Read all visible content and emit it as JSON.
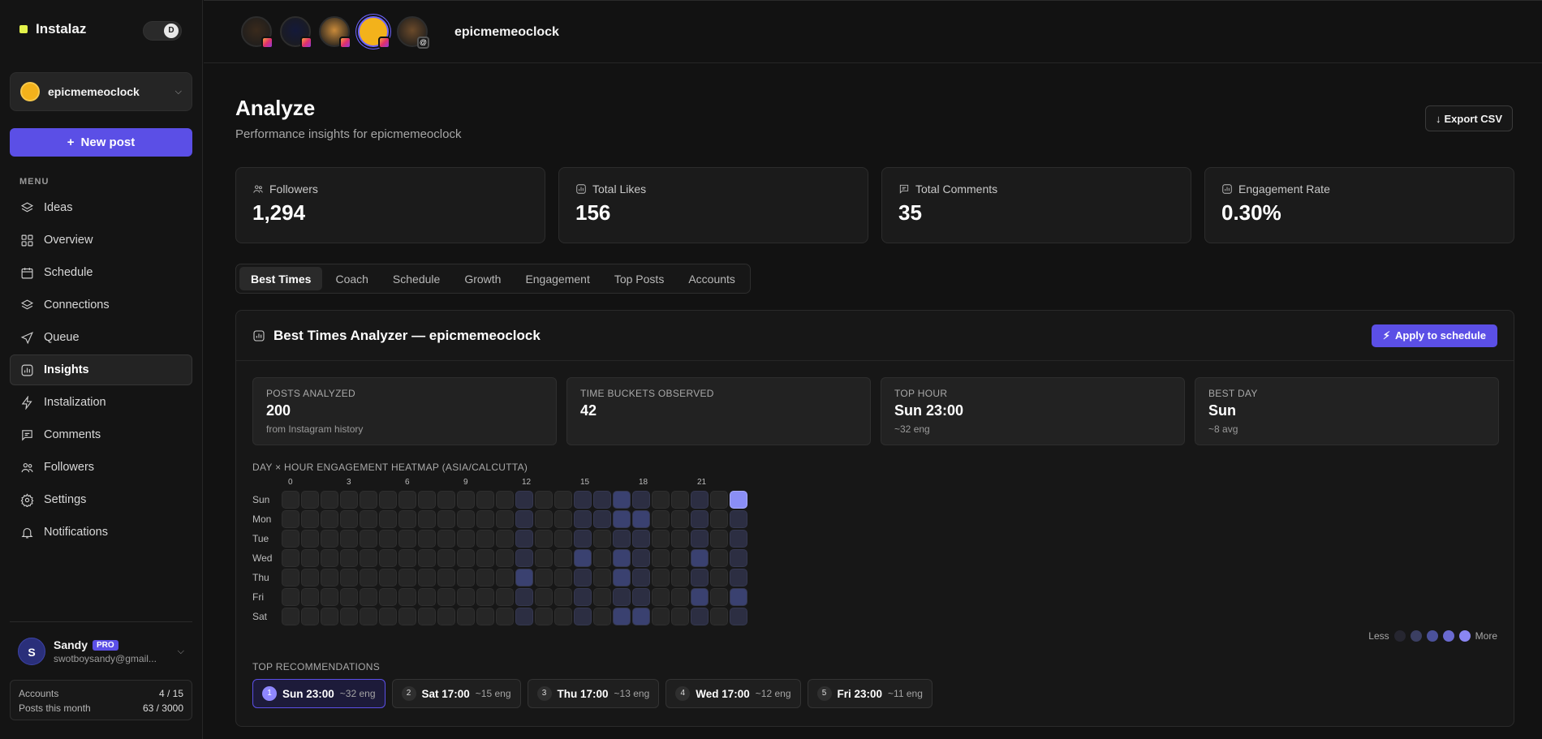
{
  "app": {
    "name": "Instalaz",
    "theme_toggle": "D"
  },
  "account_selector": {
    "name": "epicmemeoclock"
  },
  "new_post_label": "New post",
  "menu_label": "MENU",
  "nav": [
    {
      "label": "Ideas",
      "icon": "layers-icon",
      "active": false
    },
    {
      "label": "Overview",
      "icon": "grid-icon",
      "active": false
    },
    {
      "label": "Schedule",
      "icon": "calendar-icon",
      "active": false
    },
    {
      "label": "Connections",
      "icon": "layers-icon",
      "active": false
    },
    {
      "label": "Queue",
      "icon": "send-icon",
      "active": false
    },
    {
      "label": "Insights",
      "icon": "chart-icon",
      "active": true
    },
    {
      "label": "Instalization",
      "icon": "bolt-icon",
      "active": false
    },
    {
      "label": "Comments",
      "icon": "comment-icon",
      "active": false
    },
    {
      "label": "Followers",
      "icon": "users-icon",
      "active": false
    },
    {
      "label": "Settings",
      "icon": "gear-icon",
      "active": false
    },
    {
      "label": "Notifications",
      "icon": "bell-icon",
      "active": false
    }
  ],
  "user": {
    "initial": "S",
    "name": "Sandy",
    "plan": "PRO",
    "email": "swotboysandy@gmail..."
  },
  "usage": {
    "accounts_label": "Accounts",
    "accounts_value": "4 / 15",
    "posts_label": "Posts this month",
    "posts_value": "63 / 3000"
  },
  "topbar": {
    "accounts": [
      {
        "name": "tiger",
        "color": "#3a2a1c",
        "badge": "instagram"
      },
      {
        "name": "crest",
        "color": "#14193a",
        "badge": "instagram"
      },
      {
        "name": "cartoon",
        "color": "#c98a3a",
        "badge": "instagram"
      },
      {
        "name": "epicmemeoclock",
        "color": "#f3b21b",
        "badge": "instagram",
        "selected": true
      },
      {
        "name": "lion",
        "color": "#6b4a2a",
        "badge": "threads"
      }
    ],
    "current_account": "epicmemeoclock"
  },
  "page": {
    "title": "Analyze",
    "subtitle": "Performance insights for epicmemeoclock",
    "export_label": "Export CSV"
  },
  "stats": [
    {
      "label": "Followers",
      "value": "1,294",
      "icon": "users-icon"
    },
    {
      "label": "Total Likes",
      "value": "156",
      "icon": "chart-icon"
    },
    {
      "label": "Total Comments",
      "value": "35",
      "icon": "comment-icon"
    },
    {
      "label": "Engagement Rate",
      "value": "0.30%",
      "icon": "chart-icon"
    }
  ],
  "tabs": [
    "Best Times",
    "Coach",
    "Schedule",
    "Growth",
    "Engagement",
    "Top Posts",
    "Accounts"
  ],
  "active_tab": "Best Times",
  "panel": {
    "title": "Best Times Analyzer — epicmemeoclock",
    "apply_label": "Apply to schedule"
  },
  "metrics": [
    {
      "label": "POSTS ANALYZED",
      "value": "200",
      "note": "from Instagram history"
    },
    {
      "label": "TIME BUCKETS OBSERVED",
      "value": "42",
      "note": ""
    },
    {
      "label": "TOP HOUR",
      "value": "Sun 23:00",
      "note": "~32 eng"
    },
    {
      "label": "BEST DAY",
      "value": "Sun",
      "note": "~8 avg"
    }
  ],
  "heatmap": {
    "title": "DAY × HOUR ENGAGEMENT HEATMAP (ASIA/CALCUTTA)",
    "hour_labels": [
      "0",
      "3",
      "6",
      "9",
      "12",
      "15",
      "18",
      "21"
    ],
    "days": [
      "Sun",
      "Mon",
      "Tue",
      "Wed",
      "Thu",
      "Fri",
      "Sat"
    ],
    "levels": [
      [
        0,
        0,
        0,
        0,
        0,
        0,
        0,
        0,
        0,
        0,
        0,
        0,
        1,
        0,
        0,
        1,
        1,
        2,
        1,
        0,
        0,
        1,
        0,
        4
      ],
      [
        0,
        0,
        0,
        0,
        0,
        0,
        0,
        0,
        0,
        0,
        0,
        0,
        1,
        0,
        0,
        1,
        1,
        2,
        2,
        0,
        0,
        1,
        0,
        1
      ],
      [
        0,
        0,
        0,
        0,
        0,
        0,
        0,
        0,
        0,
        0,
        0,
        0,
        1,
        0,
        0,
        1,
        0,
        1,
        1,
        0,
        0,
        1,
        0,
        1
      ],
      [
        0,
        0,
        0,
        0,
        0,
        0,
        0,
        0,
        0,
        0,
        0,
        0,
        1,
        0,
        0,
        2,
        0,
        2,
        1,
        0,
        0,
        2,
        0,
        1
      ],
      [
        0,
        0,
        0,
        0,
        0,
        0,
        0,
        0,
        0,
        0,
        0,
        0,
        2,
        0,
        0,
        1,
        0,
        2,
        1,
        0,
        0,
        1,
        0,
        1
      ],
      [
        0,
        0,
        0,
        0,
        0,
        0,
        0,
        0,
        0,
        0,
        0,
        0,
        1,
        0,
        0,
        1,
        0,
        1,
        1,
        0,
        0,
        2,
        0,
        2
      ],
      [
        0,
        0,
        0,
        0,
        0,
        0,
        0,
        0,
        0,
        0,
        0,
        0,
        1,
        0,
        0,
        1,
        0,
        2,
        2,
        0,
        0,
        1,
        0,
        1
      ]
    ],
    "level_colors": [
      "#262626",
      "#2c2e42",
      "#3a4170",
      "#5a61b8",
      "#8a8ef5"
    ],
    "legend_less": "Less",
    "legend_more": "More",
    "legend_colors": [
      "#262630",
      "#3b3f62",
      "#4b519a",
      "#6a6ad0",
      "#8a86f2"
    ]
  },
  "recommendations": {
    "title": "TOP RECOMMENDATIONS",
    "items": [
      {
        "rank": "1",
        "slot": "Sun 23:00",
        "eng": "~32 eng"
      },
      {
        "rank": "2",
        "slot": "Sat 17:00",
        "eng": "~15 eng"
      },
      {
        "rank": "3",
        "slot": "Thu 17:00",
        "eng": "~13 eng"
      },
      {
        "rank": "4",
        "slot": "Wed 17:00",
        "eng": "~12 eng"
      },
      {
        "rank": "5",
        "slot": "Fri 23:00",
        "eng": "~11 eng"
      }
    ]
  }
}
